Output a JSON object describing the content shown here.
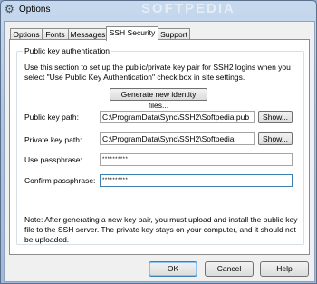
{
  "window": {
    "title": "Options",
    "watermark": "SOFTPEDIA"
  },
  "tabs": [
    {
      "label": "Options",
      "active": false
    },
    {
      "label": "Fonts",
      "active": false
    },
    {
      "label": "Messages",
      "active": false
    },
    {
      "label": "SSH Security",
      "active": true
    },
    {
      "label": "Support",
      "active": false
    }
  ],
  "group": {
    "title": "Public key authentication",
    "description": "Use this section to set up the public/private key pair for SSH2 logins when you select \"Use Public Key Authentication\" check box in site settings.",
    "generate_label": "Generate new identity files...",
    "public_key": {
      "label": "Public key path:",
      "value": "C:\\ProgramData\\Sync\\SSH2\\Softpedia.pub",
      "show_label": "Show..."
    },
    "private_key": {
      "label": "Private key path:",
      "value": "C:\\ProgramData\\Sync\\SSH2\\Softpedia",
      "show_label": "Show..."
    },
    "passphrase": {
      "label": "Use passphrase:",
      "value": "**********"
    },
    "confirm": {
      "label": "Confirm passphrase:",
      "value": "**********"
    },
    "note": "Note: After generating a new key pair, you must upload and install the public key file to the SSH server. The private key stays on your computer, and it should not be uploaded."
  },
  "buttons": {
    "ok": "OK",
    "cancel": "Cancel",
    "help": "Help"
  }
}
